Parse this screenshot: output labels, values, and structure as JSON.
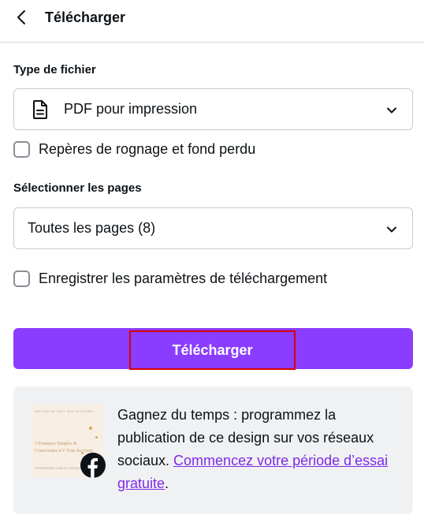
{
  "header": {
    "title": "Télécharger",
    "back_icon": "chevron-left-icon"
  },
  "file_type": {
    "label": "Type de fichier",
    "selected": "PDF pour impression",
    "icon": "file-document-icon"
  },
  "crop_marks": {
    "label": "Repères de rognage et fond perdu",
    "checked": false
  },
  "pages": {
    "label": "Sélectionner les pages",
    "selected": "Toutes les pages (8)"
  },
  "save_settings": {
    "label": "Enregistrer les paramètres de téléchargement",
    "checked": false
  },
  "download_button": {
    "label": "Télécharger"
  },
  "promo": {
    "text": "Gagnez du temps : programmez la publication de ce design sur vos réseaux sociaux. ",
    "link": "Commencez votre période d’essai gratuite",
    "suffix": ".",
    "thumbnail": {
      "top_text": "ÉDITION DE TOUT SUR LE SCORE",
      "title": "3 Pratiques Simples & Conscientes à V Tous les Jours",
      "footer": "APPRENDRE À MIEUX RESSENTIR"
    },
    "social_icon": "facebook-icon"
  },
  "colors": {
    "accent": "#8b3dff",
    "link": "#7d2ae8",
    "highlight_border": "#d60000",
    "promo_bg": "#f0f1f3"
  }
}
